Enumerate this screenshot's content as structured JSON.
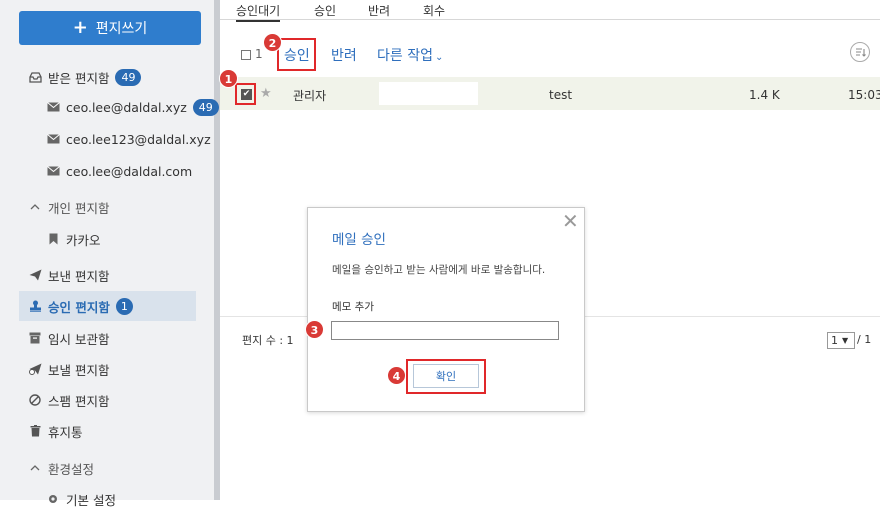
{
  "sidebar": {
    "compose_label": "편지쓰기",
    "inbox": {
      "label": "받은 편지함",
      "count": "49"
    },
    "accounts": [
      {
        "label": "ceo.lee@daldal.xyz",
        "count": "49"
      },
      {
        "label": "ceo.lee123@daldal.xyz"
      },
      {
        "label": "ceo.lee@daldal.com"
      }
    ],
    "personal_section": "개인 편지함",
    "personal_items": [
      {
        "label": "카카오"
      }
    ],
    "sent": "보낸 편지함",
    "approval": {
      "label": "승인 편지함",
      "count": "1"
    },
    "drafts": "임시 보관함",
    "scheduled": "보낼 편지함",
    "spam": "스팸 편지함",
    "trash": "휴지통",
    "settings_section": "환경설정",
    "settings_item": "기본 설정"
  },
  "tabs": [
    "승인대기",
    "승인",
    "반려",
    "회수"
  ],
  "toolbar": {
    "selected_count": "1",
    "approve": "승인",
    "reject": "반려",
    "other_actions": "다른 작업"
  },
  "mail_rows": [
    {
      "sender": "관리자",
      "subject": "test",
      "size": "1.4 K",
      "time": "15:03"
    }
  ],
  "footer": {
    "total_label": "편지 수 : 1",
    "page_current": "1",
    "page_total": "/ 1"
  },
  "modal": {
    "title": "메일 승인",
    "description": "메일을 승인하고 받는 사람에게 바로 발송합니다.",
    "memo_label": "메모 추가",
    "memo_value": "",
    "confirm_label": "확인"
  },
  "callouts": [
    "1",
    "2",
    "3",
    "4"
  ],
  "colors": {
    "accent": "#2f7dcd",
    "badge": "#2a6bb3",
    "highlight": "#e0282a",
    "callout": "#d93a36"
  }
}
